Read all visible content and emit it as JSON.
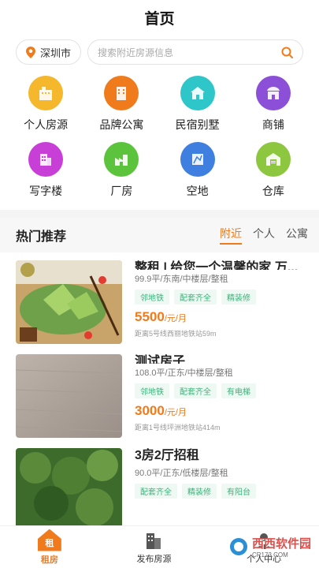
{
  "header": {
    "title": "首页"
  },
  "search": {
    "city": "深圳市",
    "placeholder": "搜索附近房源信息"
  },
  "categories": [
    {
      "label": "个人房源",
      "color": "#f5b72b",
      "icon": "building-icon"
    },
    {
      "label": "品牌公寓",
      "color": "#f07b1c",
      "icon": "apartment-icon"
    },
    {
      "label": "民宿别墅",
      "color": "#2ec6c9",
      "icon": "villa-icon"
    },
    {
      "label": "商铺",
      "color": "#8b4fd8",
      "icon": "shop-icon"
    },
    {
      "label": "写字楼",
      "color": "#c83fd8",
      "icon": "office-icon"
    },
    {
      "label": "厂房",
      "color": "#5bc33c",
      "icon": "factory-icon"
    },
    {
      "label": "空地",
      "color": "#3f7fe0",
      "icon": "land-icon"
    },
    {
      "label": "仓库",
      "color": "#8dc63f",
      "icon": "warehouse-icon"
    }
  ],
  "hot": {
    "title": "热门推荐",
    "tabs": [
      "附近",
      "个人",
      "公寓"
    ]
  },
  "listings": [
    {
      "title": "整租 | 给您一个温馨的家 万...",
      "spec": "99.9平/东南/中楼层/整租",
      "tags": [
        "邻地铁",
        "配套齐全",
        "精装修"
      ],
      "price": "5500",
      "unit": "/元/月",
      "distance": "距离5号线西丽地铁站59m"
    },
    {
      "title": "测试房子",
      "spec": "108.0平/正东/中楼层/整租",
      "tags": [
        "邻地铁",
        "配套齐全",
        "有电梯"
      ],
      "price": "3000",
      "unit": "/元/月",
      "distance": "距离1号线坪洲地铁站414m"
    },
    {
      "title": "3房2厅招租",
      "spec": "90.0平/正东/低楼层/整租",
      "tags": [
        "配套齐全",
        "精装修",
        "有阳台"
      ],
      "price": "",
      "unit": "",
      "distance": ""
    }
  ],
  "nav": {
    "home_icon_text": "租",
    "home": "租房",
    "publish": "发布房源",
    "profile": "个人中心"
  },
  "watermark": {
    "brand": "西西软件园",
    "sub": "CR173.COM"
  }
}
